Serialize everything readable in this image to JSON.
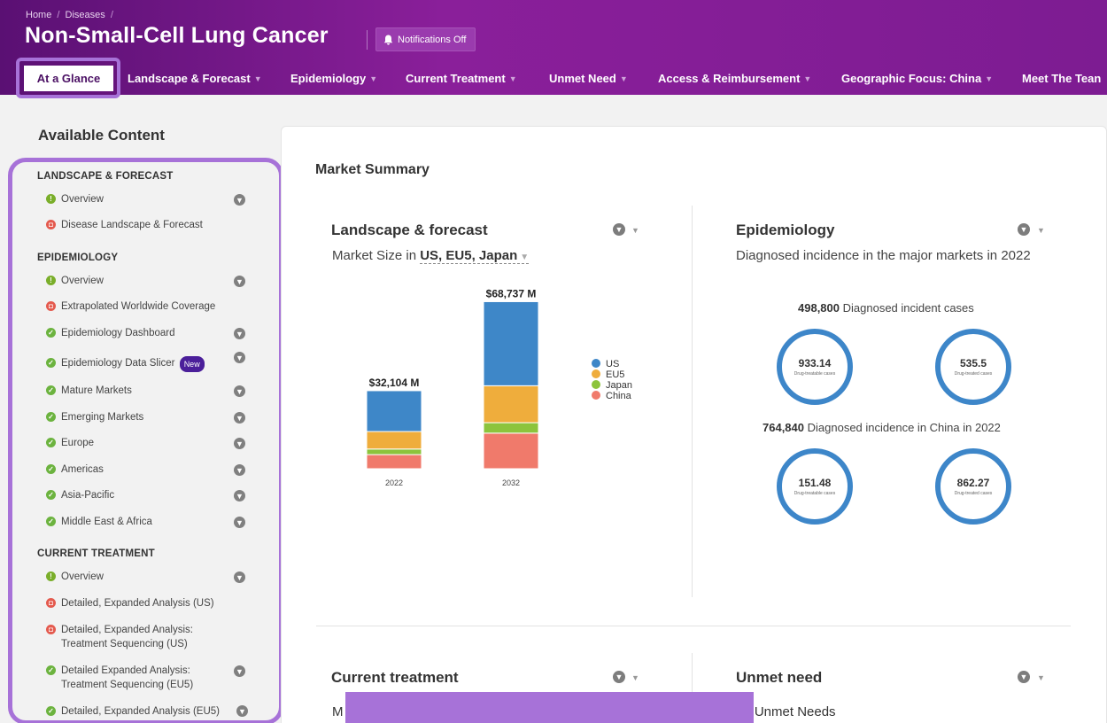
{
  "breadcrumb": {
    "home": "Home",
    "sep": "/",
    "diseases": "Diseases",
    "trail_sep": "/"
  },
  "page_title": "Non-Small-Cell Lung Cancer",
  "notifications_label": "Notifications Off",
  "nav": {
    "active": "At a Glance",
    "items": [
      {
        "label": "Landscape & Forecast"
      },
      {
        "label": "Epidemiology"
      },
      {
        "label": "Current Treatment"
      },
      {
        "label": "Unmet Need"
      },
      {
        "label": "Access & Reimbursement"
      },
      {
        "label": "Geographic Focus: China"
      },
      {
        "label": "Meet The Tean"
      }
    ]
  },
  "sidebar": {
    "title": "Available Content",
    "sections": [
      {
        "heading": "LANDSCAPE & FORECAST"
      },
      {
        "heading": "EPIDEMIOLOGY"
      },
      {
        "heading": "CURRENT TREATMENT"
      }
    ],
    "items": [
      {
        "label": "Overview",
        "status": "info"
      },
      {
        "label": "Disease Landscape & Forecast",
        "status": "lock"
      },
      {
        "label": "Overview",
        "status": "info"
      },
      {
        "label": "Extrapolated Worldwide Coverage",
        "status": "lock"
      },
      {
        "label": "Epidemiology Dashboard",
        "status": "check"
      },
      {
        "label": "Epidemiology Data Slicer",
        "status": "check",
        "badge": "New"
      },
      {
        "label": "Mature Markets",
        "status": "check"
      },
      {
        "label": "Emerging Markets",
        "status": "check"
      },
      {
        "label": "Europe",
        "status": "check"
      },
      {
        "label": "Americas",
        "status": "check"
      },
      {
        "label": "Asia-Pacific",
        "status": "check"
      },
      {
        "label": "Middle East & Africa",
        "status": "check"
      },
      {
        "label": "Overview",
        "status": "info"
      },
      {
        "label": "Detailed, Expanded Analysis (US)",
        "status": "lock"
      },
      {
        "label": "Detailed, Expanded Analysis: Treatment Sequencing (US)",
        "status": "lock"
      },
      {
        "label": "Detailed Expanded Analysis: Treatment Sequencing (EU5)",
        "status": "check"
      },
      {
        "label": "Detailed, Expanded Analysis (EU5)",
        "status": "check"
      }
    ]
  },
  "main": {
    "title": "Market Summary",
    "landscape": {
      "title": "Landscape & forecast",
      "sub_prefix": "Market Size in",
      "markets": "US, EU5, Japan"
    },
    "epidemiology": {
      "title": "Epidemiology",
      "sub": "Diagnosed incidence in the major markets in 2022",
      "line1_value": "498,800",
      "line1_text": "Diagnosed incident cases",
      "line2_value": "764,840",
      "line2_text": "Diagnosed incidence in China in 2022",
      "rings": [
        {
          "value": "933.14",
          "label": "Drug-treatable cases"
        },
        {
          "value": "535.5",
          "label": "Drug-treated cases"
        },
        {
          "value": "151.48",
          "label": "Drug-treatable cases"
        },
        {
          "value": "862.27",
          "label": "Drug-treated cases"
        }
      ]
    },
    "current_treatment": {
      "title": "Current treatment",
      "partial": "M"
    },
    "unmet_need": {
      "title": "Unmet need",
      "partial": "op Unmet Needs"
    }
  },
  "colors": {
    "US": "#3e87c8",
    "EU5": "#efad3c",
    "Japan": "#8cc43c",
    "China": "#f07a6b"
  },
  "chart_data": {
    "type": "bar",
    "stacked": true,
    "categories": [
      "2022",
      "2032"
    ],
    "totals_labels": [
      "$32,104 M",
      "$68,737 M"
    ],
    "series": [
      {
        "name": "US",
        "values": [
          16800,
          34600
        ]
      },
      {
        "name": "EU5",
        "values": [
          7200,
          15200
        ]
      },
      {
        "name": "Japan",
        "values": [
          2300,
          4300
        ]
      },
      {
        "name": "China",
        "values": [
          5804,
          14637
        ]
      }
    ],
    "ylim": [
      0,
      70000
    ],
    "legend": "right"
  }
}
